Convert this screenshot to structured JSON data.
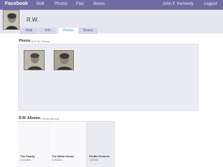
{
  "app": {
    "brand": "Fauxbook"
  },
  "nav": {
    "wall": "Wall",
    "photos": "Photos",
    "flair": "Flair",
    "boxes": "Boxes",
    "user": "John F. Kennedy",
    "logout": "Logout"
  },
  "profile": {
    "name": "R.W."
  },
  "tabs": [
    {
      "label": "Wall"
    },
    {
      "label": "Info"
    },
    {
      "label": "Photos",
      "active": true
    },
    {
      "label": "Boxes"
    }
  ],
  "photos_section": {
    "heading": "Photos",
    "subtitle": "of R.W. Photos"
  },
  "albums_section": {
    "heading": "R.W. Albums",
    "subtitle": "2 Photo Albums"
  },
  "albums": [
    {
      "title": "The Family",
      "count": "6 photos"
    },
    {
      "title": "The White House",
      "count": "4 photos"
    },
    {
      "title": "Profile Pictures",
      "count": "1 photo"
    }
  ],
  "colors": {
    "topbar": "#6f6ba3",
    "header_band": "#e6e6ee",
    "active_tab_text": "#3a9ba6"
  }
}
